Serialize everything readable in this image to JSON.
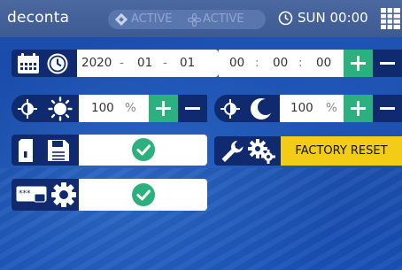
{
  "app": {
    "brand": "deconta"
  },
  "topbar": {
    "status_1": "ACTIVE",
    "status_2": "ACTIVE",
    "clock": "SUN 00:00",
    "icons": [
      "diamond-icon",
      "fan-icon",
      "clock-icon",
      "menu-grid-icon"
    ]
  },
  "datetime": {
    "date": {
      "year": "2020",
      "month": "01",
      "day": "01",
      "sep": "-"
    },
    "time": {
      "h": "00",
      "m": "00",
      "s": "00",
      "sep": ":"
    },
    "icons": [
      "calendar-icon",
      "clock-icon"
    ]
  },
  "brightness_day": {
    "value": "100",
    "unit": "%",
    "icons": [
      "brightness-icon",
      "sun-icon"
    ]
  },
  "brightness_night": {
    "value": "100",
    "unit": "%",
    "icons": [
      "brightness-icon",
      "moon-icon"
    ]
  },
  "save_row": {
    "icons": [
      "sd-card-icon",
      "save-icon",
      "check-icon"
    ]
  },
  "tools_row": {
    "button_label": "FACTORY RESET",
    "icons": [
      "wrench-icon",
      "gears-icon"
    ]
  },
  "password_row": {
    "icons": [
      "password-card-icon",
      "gear-icon",
      "check-icon"
    ]
  },
  "colors": {
    "accent_green": "#2db07f",
    "accent_yellow": "#f3cc16",
    "dark_blue": "#0f2a6e"
  }
}
